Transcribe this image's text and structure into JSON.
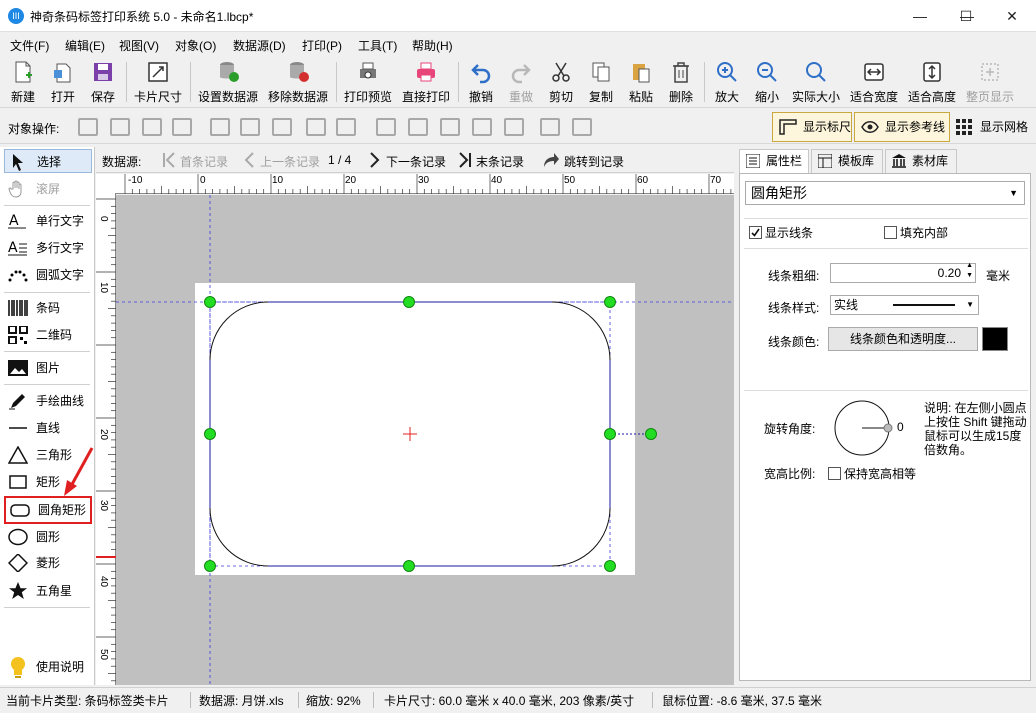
{
  "app": {
    "title": "神奇条码标签打印系统 5.0 - 未命名1.lbcp*",
    "icon_text": "III"
  },
  "window_controls": {
    "minimize": "—",
    "maximize": "☐",
    "close": "✕"
  },
  "menu": [
    "文件(F)",
    "编辑(E)",
    "视图(V)",
    "对象(O)",
    "数据源(D)",
    "打印(P)",
    "工具(T)",
    "帮助(H)"
  ],
  "toolbar": {
    "new": "新建",
    "open": "打开",
    "save": "保存",
    "card_size": "卡片尺寸",
    "set_datasource": "设置数据源",
    "remove_datasource": "移除数据源",
    "print_preview": "打印预览",
    "direct_print": "直接打印",
    "undo": "撤销",
    "redo": "重做",
    "cut": "剪切",
    "copy": "复制",
    "paste": "粘贴",
    "delete": "删除",
    "zoom_in": "放大",
    "zoom_out": "缩小",
    "actual_size": "实际大小",
    "fit_width": "适合宽度",
    "fit_height": "适合高度",
    "page_view": "整页显示"
  },
  "objbar": {
    "label": "对象操作:",
    "show_ruler": "显示标尺",
    "show_guides": "显示参考线",
    "show_grid": "显示网格"
  },
  "tools": {
    "select": "选择",
    "scroll": "滚屏",
    "single_text": "单行文字",
    "multi_text": "多行文字",
    "arc_text": "圆弧文字",
    "barcode": "条码",
    "qrcode": "二维码",
    "image": "图片",
    "freehand": "手绘曲线",
    "line": "直线",
    "triangle": "三角形",
    "rectangle": "矩形",
    "rounded_rect": "圆角矩形",
    "ellipse": "圆形",
    "diamond": "菱形",
    "star": "五角星",
    "help": "使用说明"
  },
  "navbar": {
    "label": "数据源:",
    "first": "首条记录",
    "prev": "上一条记录",
    "page": "1 / 4",
    "next": "下一条记录",
    "last": "末条记录",
    "jump": "跳转到记录"
  },
  "ruler": {
    "h_ticks": [
      "-10",
      "0",
      "10",
      "20",
      "30",
      "40",
      "50",
      "60",
      "70"
    ],
    "v_ticks": [
      "0",
      "10",
      "20",
      "30",
      "40",
      "50"
    ]
  },
  "right": {
    "tabs": {
      "properties": "属性栏",
      "templates": "模板库",
      "materials": "素材库"
    },
    "shape_type": "圆角矩形",
    "show_border": "显示线条",
    "fill_inside": "填充内部",
    "line_width_label": "线条粗细:",
    "line_width_value": "0.20",
    "line_width_unit": "毫米",
    "line_style_label": "线条样式:",
    "line_style_value": "实线",
    "line_color_label": "线条颜色:",
    "line_color_button": "线条颜色和透明度...",
    "line_color": "#000000",
    "rotation_label": "旋转角度:",
    "rotation_value": "0",
    "rotation_hint": "说明: 在左侧小圆点上按住 Shift 键拖动鼠标可以生成15度倍数角。",
    "aspect_label": "宽高比例:",
    "keep_aspect": "保持宽高相等"
  },
  "status": {
    "card_type": "当前卡片类型: 条码标签类卡片",
    "datasource": "数据源: 月饼.xls",
    "zoom": "缩放: 92%",
    "card_size": "卡片尺寸: 60.0 毫米 x 40.0 毫米, 203 像素/英寸",
    "mouse_pos": "鼠标位置: -8.6 毫米, 37.5 毫米"
  },
  "colors": {
    "handle": "#22dd22",
    "selection": "#1a1aa0",
    "highlight": "#e02020",
    "canvas": "#c0c0c0"
  }
}
